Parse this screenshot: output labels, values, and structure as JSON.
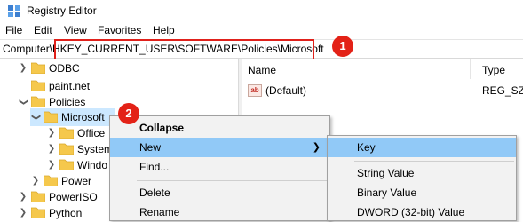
{
  "window": {
    "title": "Registry Editor"
  },
  "menu": [
    "File",
    "Edit",
    "View",
    "Favorites",
    "Help"
  ],
  "address": {
    "prefix": "Computer\\",
    "path": "HKEY_CURRENT_USER\\SOFTWARE\\Policies\\Microsoft"
  },
  "badges": {
    "one": "1",
    "two": "2"
  },
  "tree": {
    "items": [
      {
        "label": "ODBC"
      },
      {
        "label": "paint.net"
      },
      {
        "label": "Policies"
      },
      {
        "label": "Microsoft"
      },
      {
        "label": "Office"
      },
      {
        "label": "System"
      },
      {
        "label": "Windo"
      },
      {
        "label": "Power"
      },
      {
        "label": "PowerISO"
      },
      {
        "label": "Python"
      }
    ]
  },
  "values_pane": {
    "columns": {
      "name": "Name",
      "type": "Type"
    },
    "rows": [
      {
        "name": "(Default)",
        "type": "REG_SZ"
      }
    ]
  },
  "context_menu": {
    "collapse": "Collapse",
    "new": "New",
    "find": "Find...",
    "delete": "Delete",
    "rename": "Rename"
  },
  "submenu": {
    "key": "Key",
    "string_value": "String Value",
    "binary_value": "Binary Value",
    "dword_value": "DWORD (32-bit) Value"
  },
  "colors": {
    "accent": "#e32217",
    "selection": "#cce8ff",
    "menu_hover": "#91c9f7",
    "folder": "#f5c84c"
  }
}
